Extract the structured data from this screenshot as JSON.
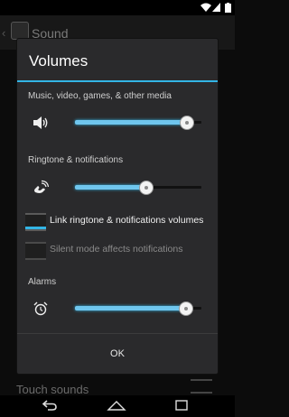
{
  "background": {
    "title": "Sound",
    "bottom_item": "Touch sounds"
  },
  "dialog": {
    "title": "Volumes",
    "media": {
      "label": "Music, video, games, & other media",
      "level": 0.88,
      "icon": "speaker-icon"
    },
    "ringtone": {
      "label": "Ringtone & notifications",
      "level": 0.56,
      "icon": "ringtone-icon"
    },
    "link_option": {
      "label": "Link ringtone & notifications volumes",
      "checked": true
    },
    "silent_option": {
      "label": "Silent mode affects notifications",
      "checked": false
    },
    "alarms": {
      "label": "Alarms",
      "level": 0.87,
      "icon": "alarm-clock-icon"
    },
    "ok_label": "OK"
  },
  "colors": {
    "accent": "#33b5e5",
    "dialog_bg": "#2a2a2c",
    "screen_bg": "#0c0c0c"
  }
}
